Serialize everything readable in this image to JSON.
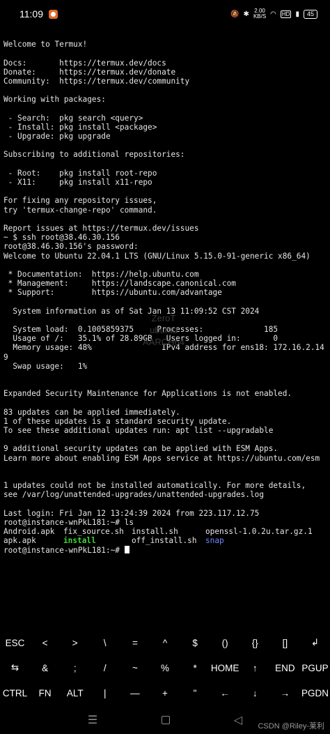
{
  "status_bar": {
    "time": "11:09",
    "speed_value": "2.00",
    "speed_unit": "KB/S",
    "hd_label": "HD",
    "battery": "45"
  },
  "terminal": {
    "lines": [
      "",
      "Welcome to Termux!",
      "",
      "Docs:       https://termux.dev/docs",
      "Donate:     https://termux.dev/donate",
      "Community:  https://termux.dev/community",
      "",
      "Working with packages:",
      "",
      " - Search:  pkg search <query>",
      " - Install: pkg install <package>",
      " - Upgrade: pkg upgrade",
      "",
      "Subscribing to additional repositories:",
      "",
      " - Root:    pkg install root-repo",
      " - X11:     pkg install x11-repo",
      "",
      "For fixing any repository issues,",
      "try 'termux-change-repo' command.",
      "",
      "Report issues at https://termux.dev/issues",
      "~ $ ssh root@38.46.30.156",
      "root@38.46.30.156's password:",
      "Welcome to Ubuntu 22.04.1 LTS (GNU/Linux 5.15.0-91-generic x86_64)",
      "",
      " * Documentation:  https://help.ubuntu.com",
      " * Management:     https://landscape.canonical.com",
      " * Support:        https://ubuntu.com/advantage",
      "",
      "  System information as of Sat Jan 13 11:09:52 CST 2024",
      "",
      "  System load:  0.1005859375     Processes:             185",
      "  Usage of /:   35.1% of 28.89GB   Users logged in:       0",
      "  Memory usage: 48%               IPv4 address for ens18: 172.16.2.14",
      "9",
      "  Swap usage:   1%",
      "",
      "",
      "Expanded Security Maintenance for Applications is not enabled.",
      "",
      "83 updates can be applied immediately.",
      "1 of these updates is a standard security update.",
      "To see these additional updates run: apt list --upgradable",
      "",
      "9 additional security updates can be applied with ESM Apps.",
      "Learn more about enabling ESM Apps service at https://ubuntu.com/esm",
      "",
      "",
      "1 updates could not be installed automatically. For more details,",
      "see /var/log/unattended-upgrades/unattended-upgrades.log",
      "",
      "Last login: Fri Jan 12 13:24:39 2024 from 223.117.12.75",
      "root@instance-wnPkL181:~# ls"
    ],
    "ls_row1": [
      "Android.apk",
      "fix_source.sh",
      "install.sh",
      "openssl-1.0.2u.tar.gz.1"
    ],
    "ls_row2": [
      "apk.apk",
      "install",
      "off_install.sh",
      "snap"
    ],
    "prompt": "root@instance-wnPkL181:~# "
  },
  "watermark": [
    "ZeroT",
    "ubuntu",
    "AARCH64"
  ],
  "extra_keys": [
    [
      "ESC",
      "<",
      ">",
      "\\",
      "=",
      "^",
      "$",
      "()",
      "{}",
      "[]",
      "↲"
    ],
    [
      "⇆",
      "&",
      ";",
      "/",
      "~",
      "%",
      "*",
      "HOME",
      "↑",
      "END",
      "PGUP"
    ],
    [
      "CTRL",
      "FN",
      "ALT",
      "|",
      "—",
      "+",
      "\"",
      "←",
      "↓",
      "→",
      "PGDN"
    ]
  ],
  "nav": {
    "recents": "☰",
    "back": "◁"
  },
  "attribution": "CSDN @Riley-莱利"
}
